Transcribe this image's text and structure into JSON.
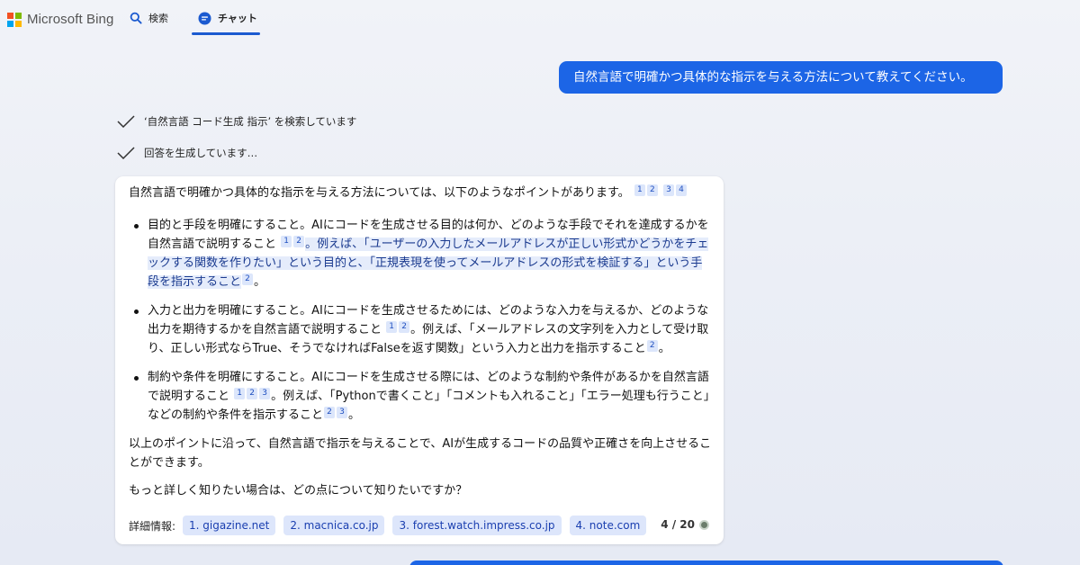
{
  "brand": {
    "name": "Microsoft Bing",
    "logo_colors": [
      "#f25022",
      "#7fba00",
      "#00a4ef",
      "#ffb900"
    ]
  },
  "nav": {
    "search_label": "検索",
    "chat_label": "チャット"
  },
  "user_message": "自然言語で明確かつ具体的な指示を与える方法について教えてください。",
  "status": {
    "line1": "‘自然言語 コード生成 指示’ を検索しています",
    "line2": "回答を生成しています…"
  },
  "answer": {
    "intro": "自然言語で明確かつ具体的な指示を与える方法については、以下のようなポイントがあります。",
    "intro_cites": [
      "1",
      "2",
      "3",
      "4"
    ],
    "points": [
      {
        "text_a": "目的と手段を明確にすること。AIにコードを生成させる目的は何か、どのような手段でそれを達成するかを自然言語で説明すること",
        "cites_a": [
          "1",
          "2"
        ],
        "text_b": "。例えば、「ユーザーの入力したメールアドレスが正しい形式かどうかをチェックする関数を作りたい」という目的と、「正規表現を使ってメールアドレスの形式を検証する」という手段を指示すること",
        "cites_b": [
          "2"
        ],
        "end": "。"
      },
      {
        "text_a": "入力と出力を明確にすること。AIにコードを生成させるためには、どのような入力を与えるか、どのような出力を期待するかを自然言語で説明すること",
        "cites_a": [
          "1",
          "2"
        ],
        "text_b": "。例えば、「メールアドレスの文字列を入力として受け取り、正しい形式ならTrue、そうでなければFalseを返す関数」という入力と出力を指示すること",
        "cites_b": [
          "2"
        ],
        "end": "。"
      },
      {
        "text_a": "制約や条件を明確にすること。AIにコードを生成させる際には、どのような制約や条件があるかを自然言語で説明すること",
        "cites_a": [
          "1",
          "2",
          "3"
        ],
        "text_b": "。例えば、「Pythonで書くこと」「コメントも入れること」「エラー処理も行うこと」などの制約や条件を指示すること",
        "cites_b": [
          "2",
          "3"
        ],
        "end": "。"
      }
    ],
    "conclusion": "以上のポイントに沿って、自然言語で指示を与えることで、AIが生成するコードの品質や正確さを向上させることができます。",
    "question": "もっと詳しく知りたい場合は、どの点について知りたいですか？"
  },
  "footer": {
    "label": "詳細情報:",
    "sources": [
      "1. gigazine.net",
      "2. macnica.co.jp",
      "3. forest.watch.impress.co.jp",
      "4. note.com"
    ],
    "counter": "4 / 20"
  },
  "colors": {
    "accent": "#1c65e6",
    "highlight_bg": "#e5ecfb",
    "chip_bg": "#dde6fb"
  }
}
